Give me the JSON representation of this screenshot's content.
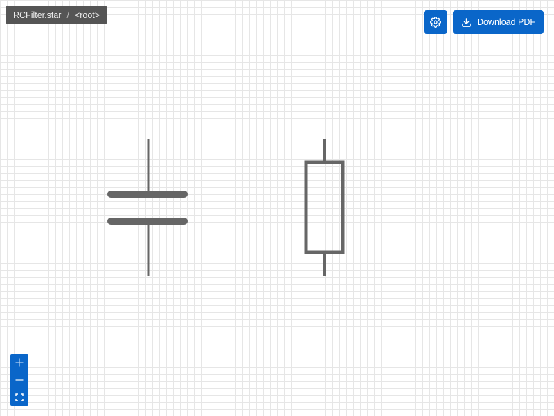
{
  "breadcrumb": {
    "file": "RCFilter.star",
    "separator": "/",
    "node": "<root>"
  },
  "toolbar": {
    "settings_icon": "gear-icon",
    "download_icon": "download-icon",
    "download_label": "Download PDF"
  },
  "zoom_controls": {
    "zoom_in_icon": "plus-icon",
    "zoom_out_icon": "minus-icon",
    "fit_icon": "fit-to-screen-icon"
  },
  "schematic": {
    "components": [
      {
        "type": "capacitor",
        "icon": "capacitor-symbol"
      },
      {
        "type": "resistor",
        "icon": "resistor-symbol"
      }
    ]
  },
  "colors": {
    "accent": "#0a66c9",
    "breadcrumb_bg": "#555555",
    "symbol_stroke": "#666666",
    "grid": "#e6e6e6"
  }
}
